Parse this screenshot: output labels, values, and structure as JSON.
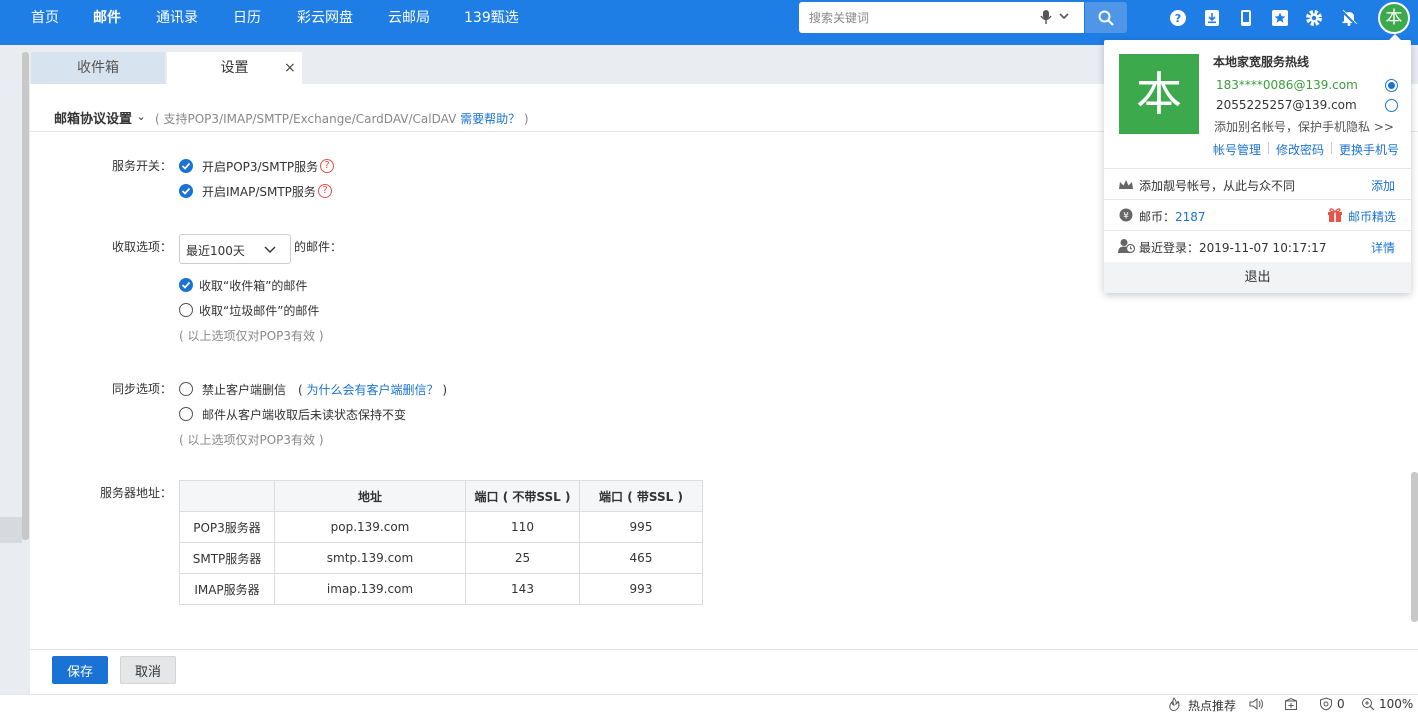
{
  "nav": {
    "items": [
      "首页",
      "邮件",
      "通讯录",
      "日历",
      "彩云网盘",
      "云邮局",
      "139甄选"
    ],
    "active_index": 1
  },
  "search": {
    "placeholder": "搜索关键词"
  },
  "header_icons": [
    "help-icon",
    "download-icon",
    "mobile-icon",
    "star-icon",
    "gear-icon",
    "bell-mute-icon"
  ],
  "avatar_char": "本",
  "tabs": {
    "inbox": "收件箱",
    "settings": "设置",
    "close": "×"
  },
  "section": {
    "title": "邮箱协议设置",
    "chevron": "⌄",
    "sub_prefix": "( 支持POP3/IMAP/SMTP/Exchange/CardDAV/CalDAV ",
    "help_link": "需要帮助？",
    "sub_suffix": " )"
  },
  "service": {
    "label": "服务开关：",
    "options": [
      {
        "label": "开启POP3/SMTP服务",
        "checked": true
      },
      {
        "label": "开启IMAP/SMTP服务",
        "checked": true
      }
    ]
  },
  "fetch": {
    "label": "收取选项：",
    "select_value": "最近100天",
    "suffix": "的邮件：",
    "options": [
      {
        "label": "收取“收件箱”的邮件",
        "checked": true
      },
      {
        "label": "收取“垃圾邮件”的邮件",
        "checked": false
      }
    ],
    "note": "( 以上选项仅对POP3有效 )"
  },
  "sync": {
    "label": "同步选项：",
    "options": [
      {
        "label": "禁止客户端删信",
        "checked": false
      },
      {
        "label": "邮件从客户端收取后未读状态保持不变",
        "checked": false
      }
    ],
    "why_prefix": "( ",
    "why_link": "为什么会有客户端删信？",
    "why_suffix": " )",
    "note": "( 以上选项仅对POP3有效 )"
  },
  "server": {
    "label": "服务器地址：",
    "headers": [
      "",
      "地址",
      "端口 ( 不带SSL )",
      "端口 ( 带SSL )"
    ],
    "rows": [
      [
        "POP3服务器",
        "pop.139.com",
        "110",
        "995"
      ],
      [
        "SMTP服务器",
        "smtp.139.com",
        "25",
        "465"
      ],
      [
        "IMAP服务器",
        "imap.139.com",
        "143",
        "993"
      ]
    ]
  },
  "buttons": {
    "save": "保存",
    "cancel": "取消"
  },
  "status": {
    "hot": "热点推荐",
    "count": "0",
    "zoom": "100%"
  },
  "popover": {
    "avatar_char": "本",
    "hotline": "本地家宽服务热线",
    "accounts": [
      {
        "address": "183****0086@139.com",
        "selected": true
      },
      {
        "address": "2055225257@139.com",
        "selected": false
      }
    ],
    "alias": "添加别名帐号，保护手机隐私 >>",
    "links": [
      "帐号管理",
      "修改密码",
      "更换手机号"
    ],
    "vip_text": "添加靓号帐号，从此与众不同",
    "vip_link": "添加",
    "coin_label": "邮币：",
    "coin_value": "2187",
    "coin_link": "邮币精选",
    "login_label": "最近登录：2019-11-07 10:17:17",
    "login_link": "详情",
    "logout": "退出"
  },
  "colors": {
    "brand": "#1f7de6",
    "accent": "#1a73d4",
    "avatar": "#3caa4c"
  }
}
